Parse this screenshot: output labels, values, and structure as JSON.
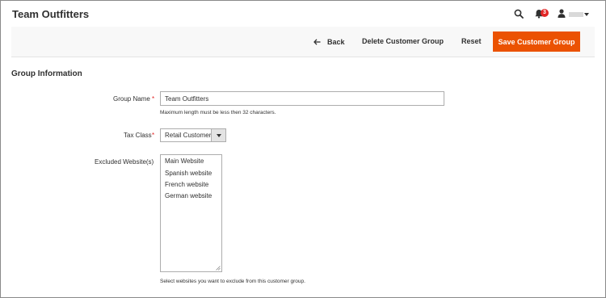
{
  "header": {
    "title": "Team Outfitters",
    "notification_count": "3",
    "icons": {
      "search": "search-icon",
      "notifications": "bell-icon",
      "account": "user-icon",
      "menu": "chevron-down-icon"
    }
  },
  "actions": {
    "back_label": "Back",
    "delete_label": "Delete Customer Group",
    "reset_label": "Reset",
    "save_label": "Save Customer Group"
  },
  "colors": {
    "accent": "#eb5202",
    "required": "#e22626",
    "text": "#303030"
  },
  "form": {
    "section_title": "Group Information",
    "group_name": {
      "label": "Group Name",
      "required_mark": "*",
      "value": "Team Outfitters",
      "note": "Maximum length must be less then 32 characters."
    },
    "tax_class": {
      "label": "Tax Class",
      "required_mark": "*",
      "selected": "Retail Customer"
    },
    "excluded_websites": {
      "label": "Excluded Website(s)",
      "options": [
        "Main Website",
        "Spanish website",
        "French website",
        "German website"
      ],
      "note": "Select websites you want to exclude from this customer group."
    }
  }
}
